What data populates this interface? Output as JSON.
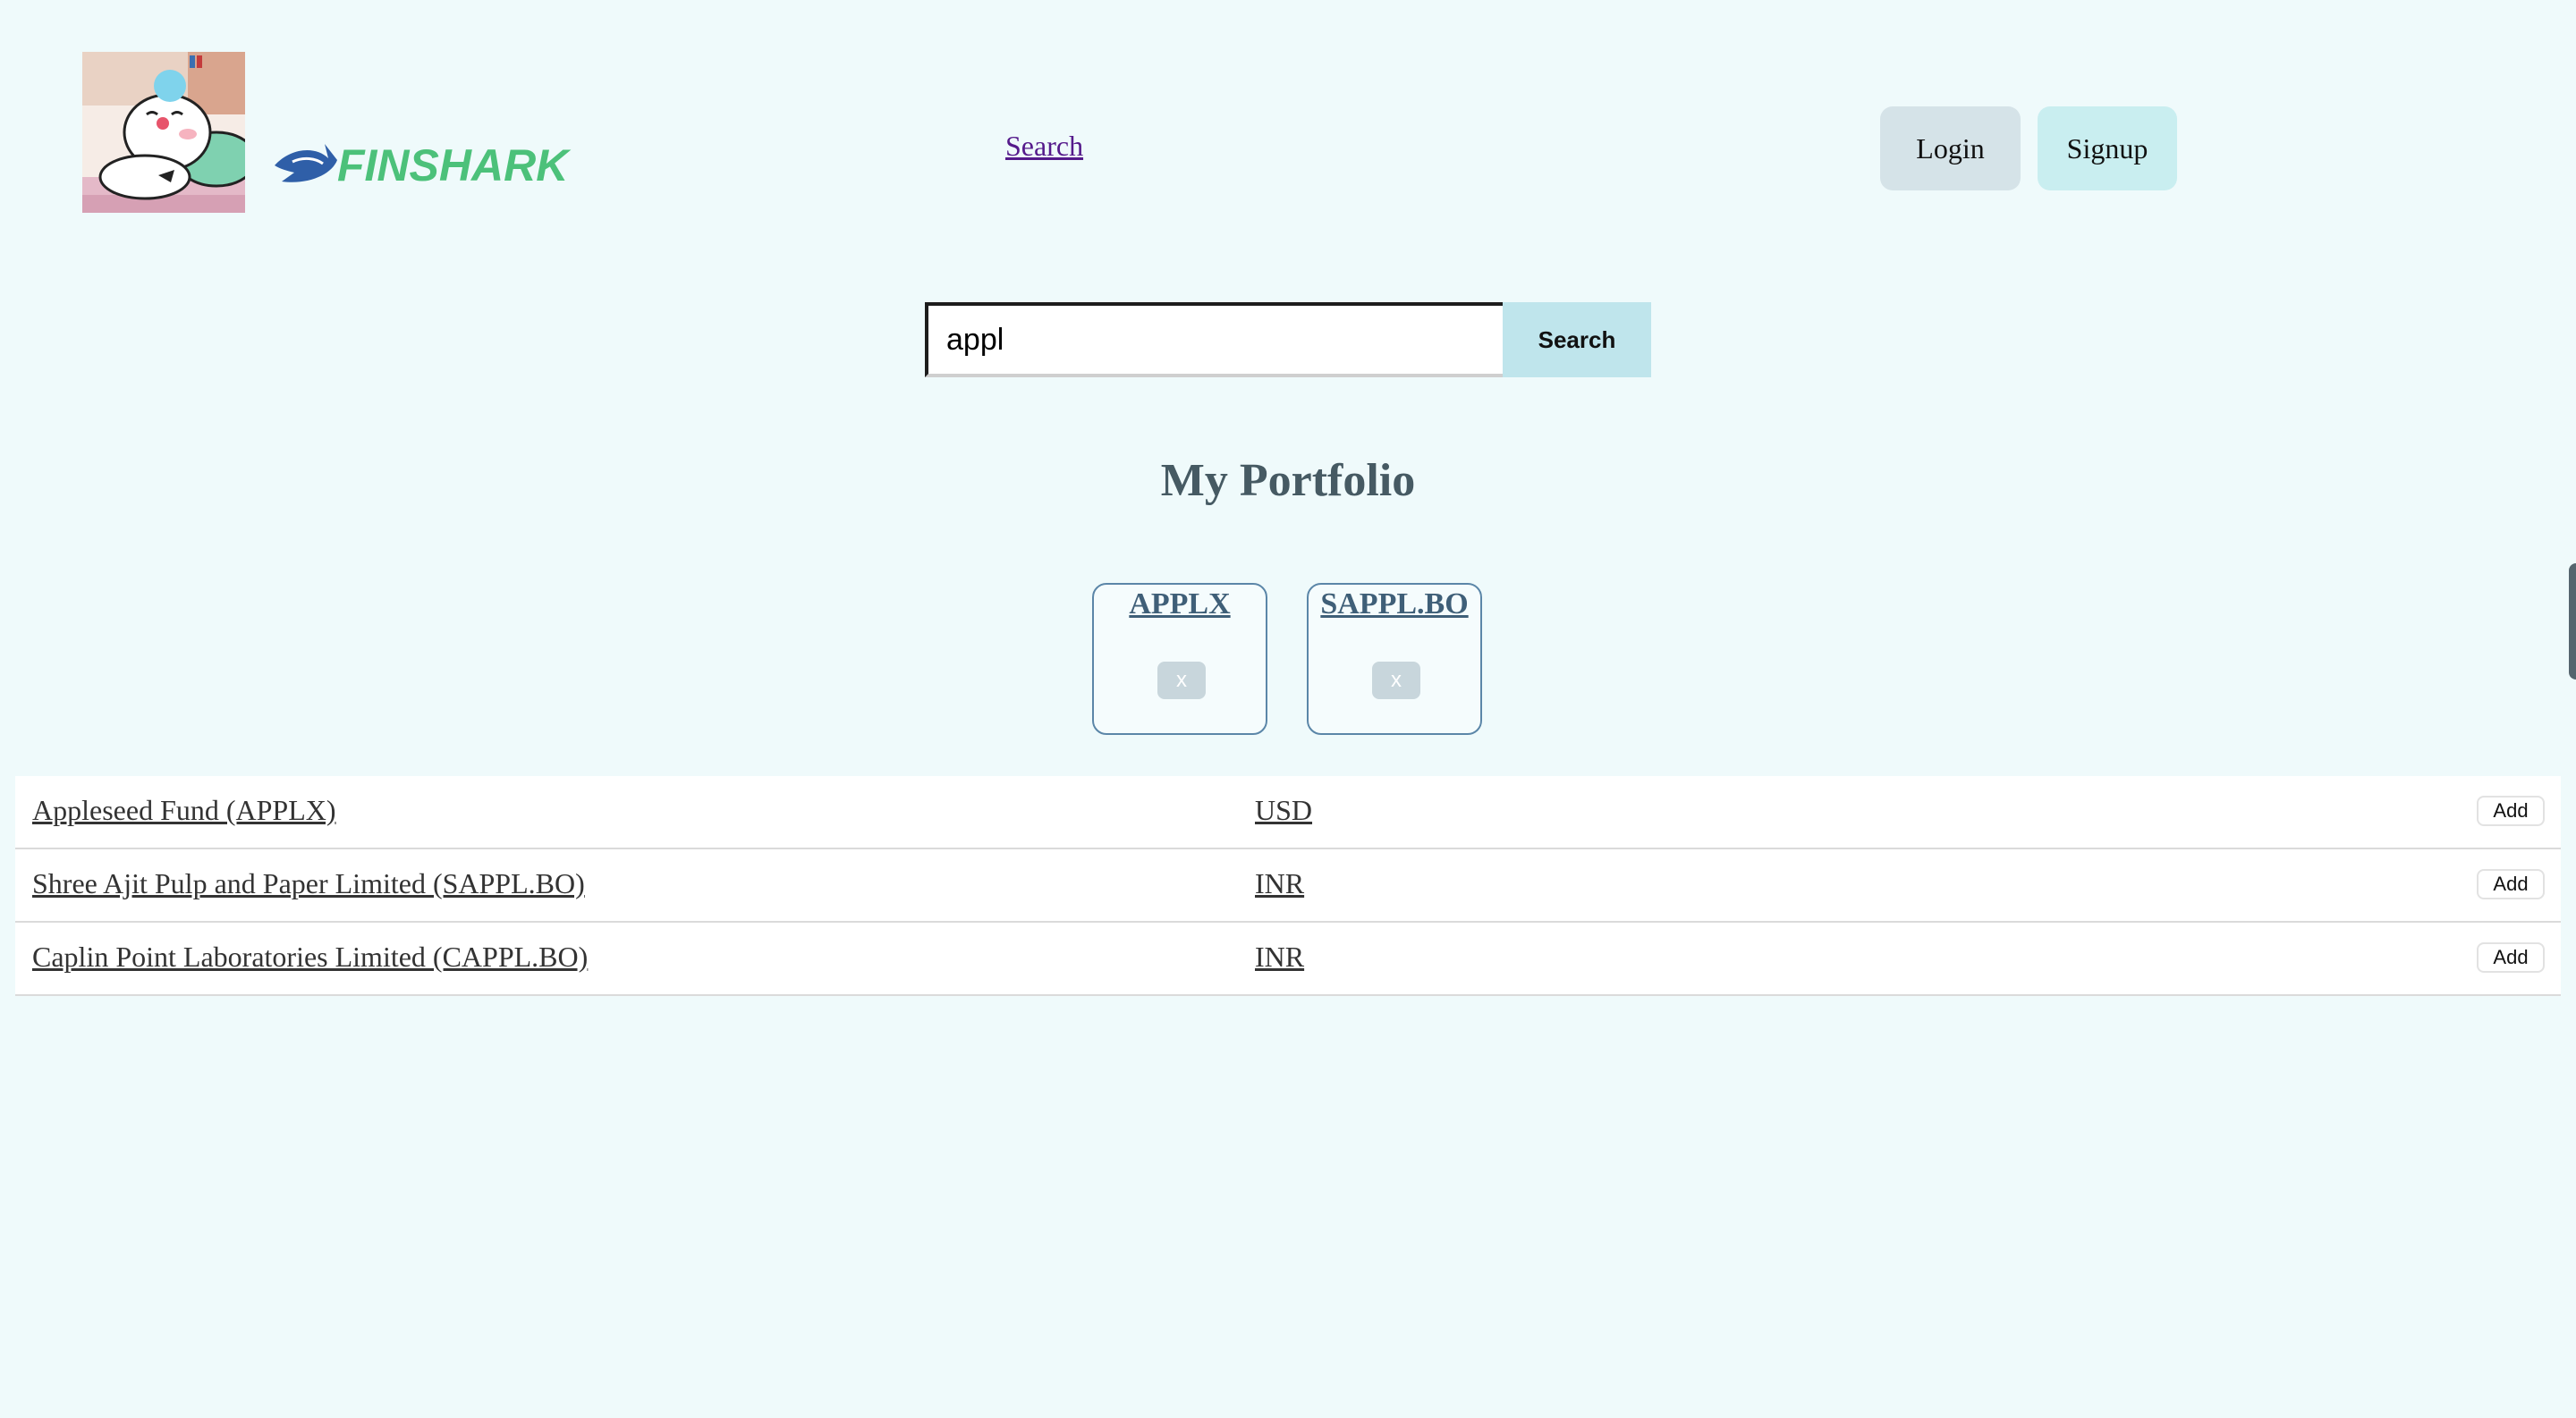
{
  "header": {
    "brand_name": "FINSHARK",
    "nav_search_label": "Search",
    "login_label": "Login",
    "signup_label": "Signup"
  },
  "search": {
    "value": "appl",
    "button_label": "Search"
  },
  "portfolio": {
    "title": "My Portfolio",
    "items": [
      {
        "symbol": "APPLX",
        "remove_label": "x"
      },
      {
        "symbol": "SAPPL.BO",
        "remove_label": "x"
      }
    ]
  },
  "results": [
    {
      "name": "Appleseed Fund (APPLX)",
      "currency": "USD",
      "add_label": "Add"
    },
    {
      "name": "Shree Ajit Pulp and Paper Limited (SAPPL.BO)",
      "currency": "INR",
      "add_label": "Add"
    },
    {
      "name": "Caplin Point Laboratories Limited (CAPPL.BO)",
      "currency": "INR",
      "add_label": "Add"
    }
  ],
  "colors": {
    "background": "#effafb",
    "brand_green": "#4cc17a",
    "brand_blue": "#2f5fa8",
    "login_bg": "#d5e3e8",
    "signup_bg": "#c9eef0",
    "search_btn_bg": "#bfe5ec",
    "portfolio_title": "#465a63"
  }
}
